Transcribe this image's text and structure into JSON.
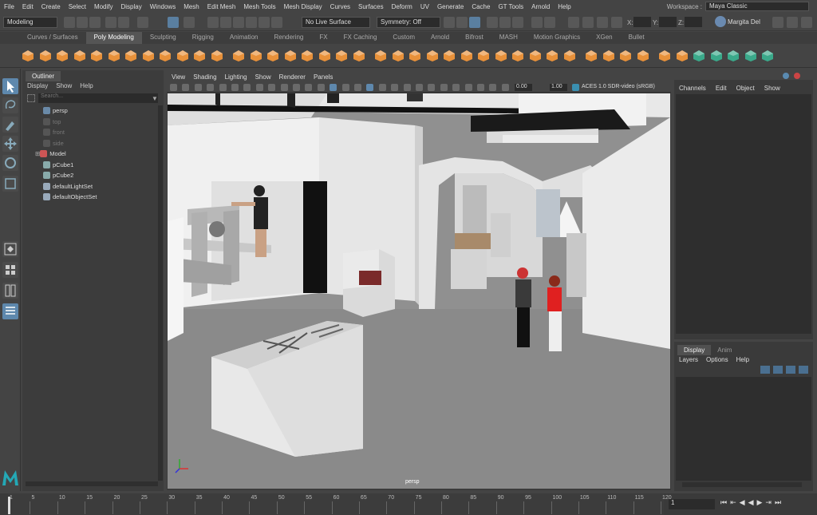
{
  "menubar": {
    "items": [
      "File",
      "Edit",
      "Create",
      "Select",
      "Modify",
      "Display",
      "Windows",
      "Mesh",
      "Edit Mesh",
      "Mesh Tools",
      "Mesh Display",
      "Curves",
      "Surfaces",
      "Deform",
      "UV",
      "Generate",
      "Cache",
      "GT Tools",
      "Arnold",
      "Help"
    ],
    "workspace_label": "Workspace :",
    "workspace_value": "Maya Classic"
  },
  "status": {
    "mode": "Modeling",
    "live_surface": "No Live Surface",
    "symmetry": "Symmetry: Off",
    "x_label": "X:",
    "y_label": "Y:",
    "z_label": "Z:",
    "user": "Margita Del"
  },
  "shelf_tabs": [
    "Curves / Surfaces",
    "Poly Modeling",
    "Sculpting",
    "Rigging",
    "Animation",
    "Rendering",
    "FX",
    "FX Caching",
    "Custom",
    "Arnold",
    "Bifrost",
    "MASH",
    "Motion Graphics",
    "XGen",
    "Bullet"
  ],
  "shelf_active": "Poly Modeling",
  "outliner": {
    "tab": "Outliner",
    "menu": [
      "Display",
      "Show",
      "Help"
    ],
    "search_placeholder": "Search...",
    "items": [
      {
        "label": "persp",
        "dim": false,
        "indent": 1
      },
      {
        "label": "top",
        "dim": true,
        "indent": 1
      },
      {
        "label": "front",
        "dim": true,
        "indent": 1
      },
      {
        "label": "side",
        "dim": true,
        "indent": 1
      },
      {
        "label": "Model",
        "dim": false,
        "indent": 0
      },
      {
        "label": "pCube1",
        "dim": false,
        "indent": 1
      },
      {
        "label": "pCube2",
        "dim": false,
        "indent": 1
      },
      {
        "label": "defaultLightSet",
        "dim": false,
        "indent": 1
      },
      {
        "label": "defaultObjectSet",
        "dim": false,
        "indent": 1
      }
    ]
  },
  "viewport": {
    "menu": [
      "View",
      "Shading",
      "Lighting",
      "Show",
      "Renderer",
      "Panels"
    ],
    "exposure": "0.00",
    "gamma": "1.00",
    "color_space": "ACES 1.0 SDR-video (sRGB)",
    "camera": "persp"
  },
  "channels": {
    "menu": [
      "Channels",
      "Edit",
      "Object",
      "Show"
    ]
  },
  "layers": {
    "tabs": [
      "Display",
      "Anim"
    ],
    "menu": [
      "Layers",
      "Options",
      "Help"
    ]
  },
  "timeline": {
    "ticks": [
      "1",
      "5",
      "10",
      "15",
      "20",
      "25",
      "30",
      "35",
      "40",
      "45",
      "50",
      "55",
      "60",
      "65",
      "70",
      "75",
      "80",
      "85",
      "90",
      "95",
      "100",
      "105",
      "110",
      "115",
      "120"
    ],
    "current_frame": "1"
  },
  "colors": {
    "accent": "#5e88ad",
    "shelf_orange": "#e8913a",
    "shelf_green": "#3aa98a",
    "bg": "#444444"
  }
}
